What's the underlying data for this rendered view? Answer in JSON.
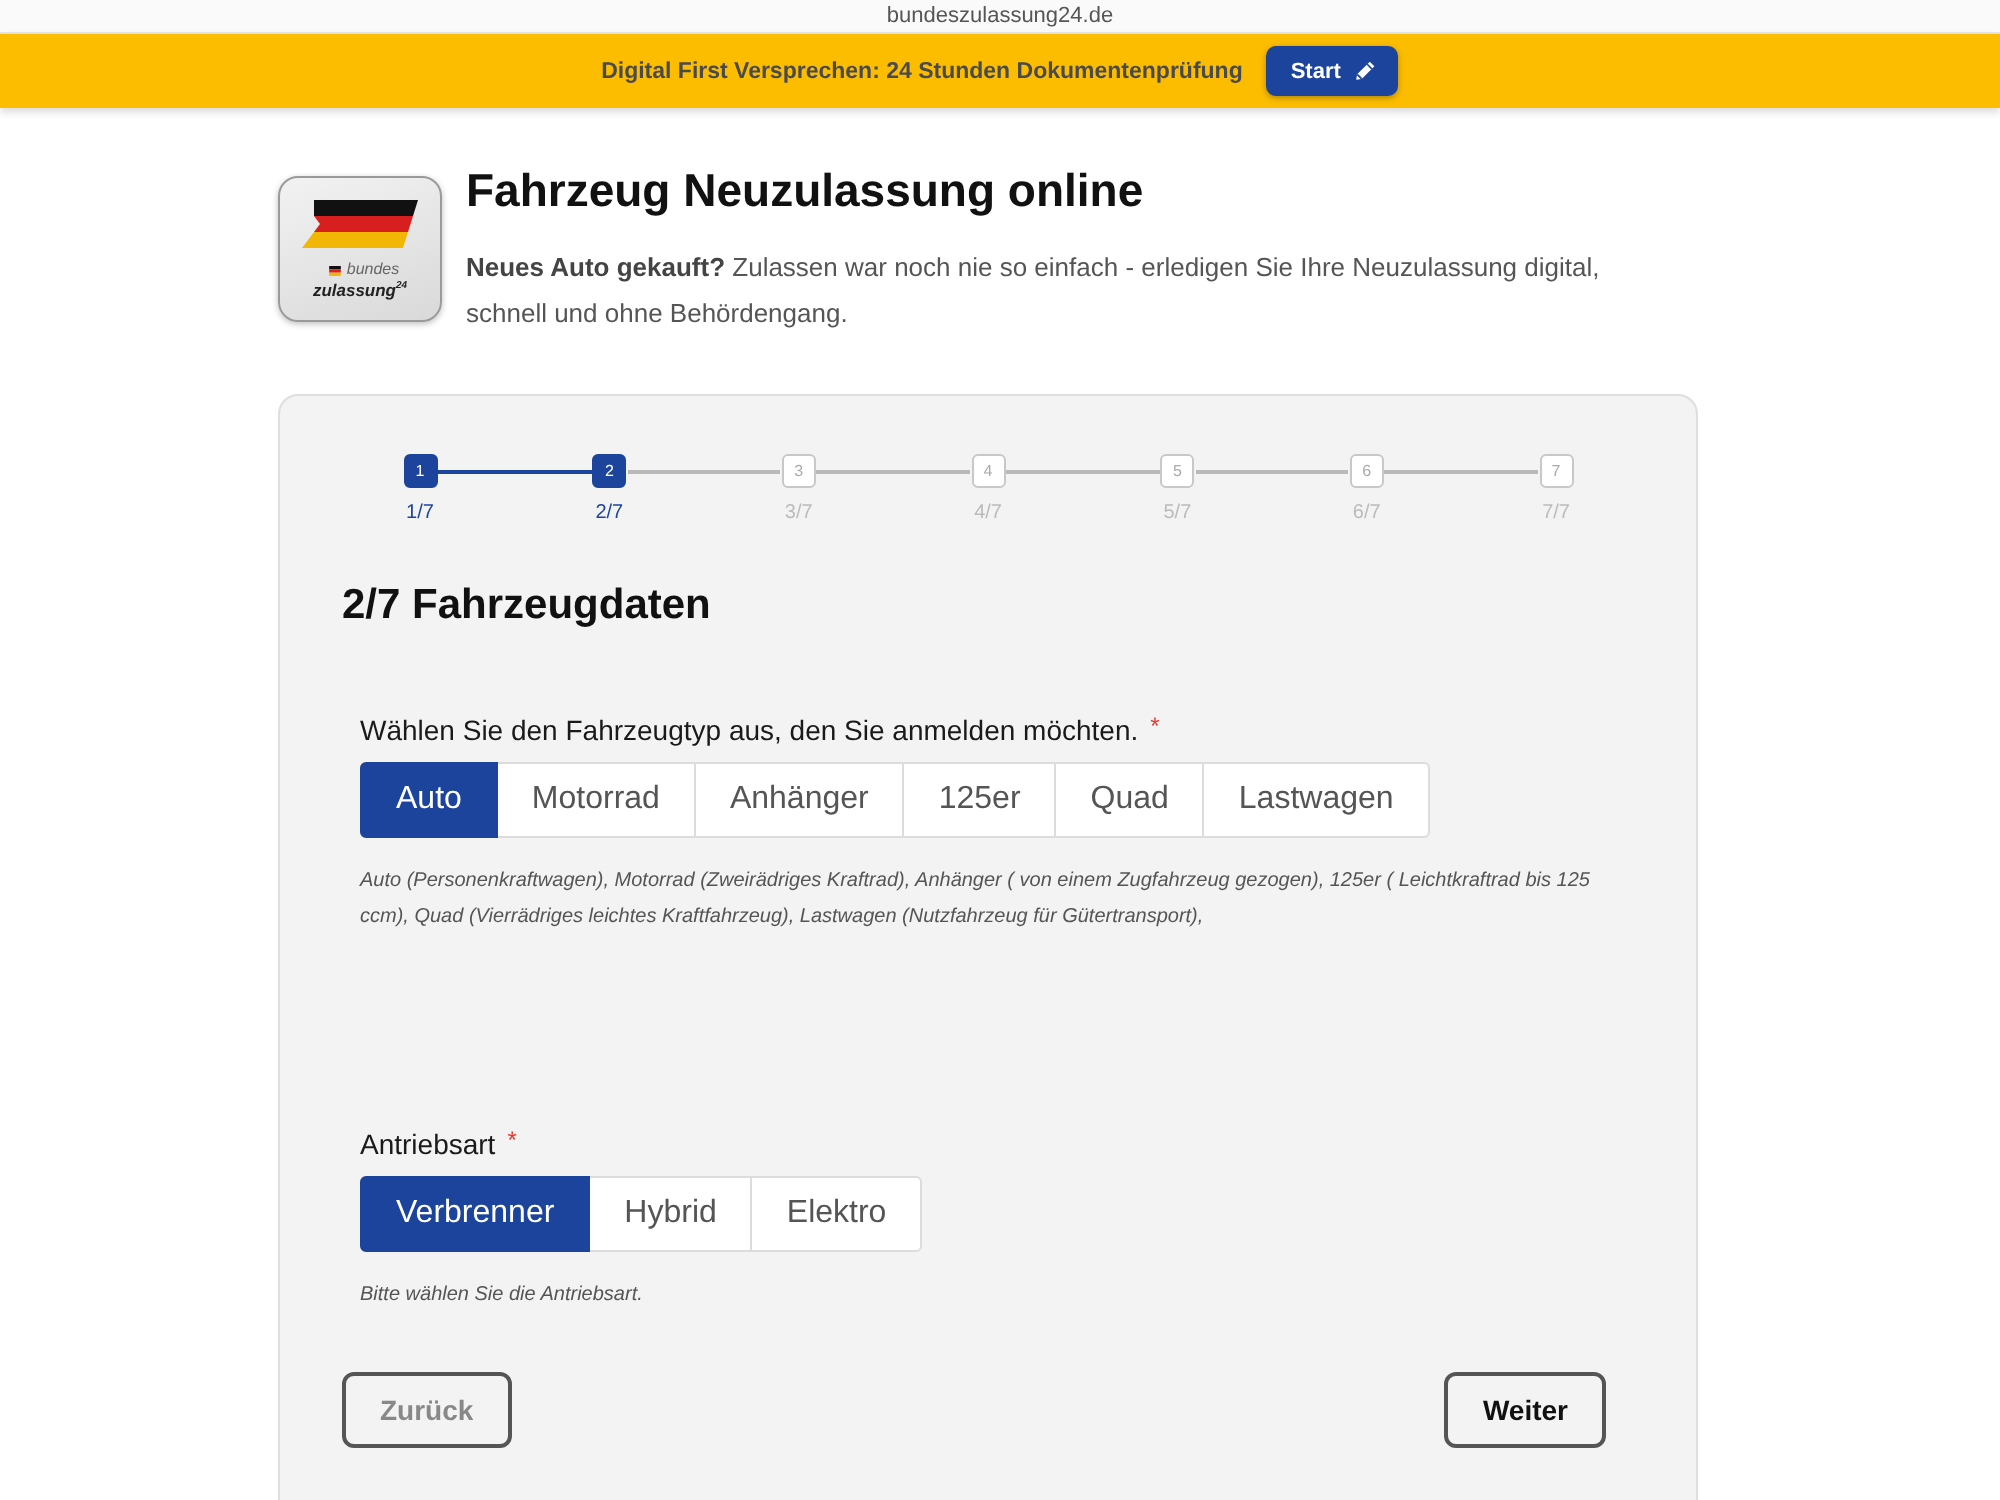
{
  "browser": {
    "url": "bundeszulassung24.de"
  },
  "banner": {
    "text": "Digital First Versprechen: 24 Stunden Dokumentenprüfung",
    "button": {
      "label": "Start"
    }
  },
  "header": {
    "logo": {
      "line_1": "bundes",
      "line_2": "zulassung$^{24}$"
    },
    "title": "Fahrzeug Neuzulassung online",
    "intro": "**Neues Auto gekauft?** Zulassen war noch nie so einfach - erledigen Sie Ihre Neuzulassung digital, schnell und ohne Behördengang."
  },
  "stepper": {
    "steps": [
      {
        "number": "1",
        "label": "1/7",
        "completed": true
      },
      {
        "number": "2",
        "label": "2/7",
        "completed": true
      },
      {
        "number": "3",
        "label": "3/7",
        "completed": false
      },
      {
        "number": "4",
        "label": "4/7",
        "completed": false
      },
      {
        "number": "5",
        "label": "5/7",
        "completed": false
      },
      {
        "number": "6",
        "label": "6/7",
        "completed": false
      },
      {
        "number": "7",
        "label": "7/7",
        "completed": false
      }
    ]
  },
  "form": {
    "heading": "2/7 Fahrzeugdaten",
    "fields": [
      {
        "label": "Wählen Sie den Fahrzeugtyp aus, den Sie anmelden möchten.",
        "required_mark": "*",
        "options": [
          {
            "label": "Auto",
            "selected": true
          },
          {
            "label": "Motorrad",
            "selected": false
          },
          {
            "label": "Anhänger",
            "selected": false
          },
          {
            "label": "125er",
            "selected": false
          },
          {
            "label": "Quad",
            "selected": false
          },
          {
            "label": "Lastwagen",
            "selected": false
          }
        ],
        "help": "Auto (Personenkraftwagen), Motorrad (Zweirädriges Kraftrad), Anhänger ( von einem Zugfahrzeug gezogen), 125er ( Leichtkraftrad bis 125 ccm), Quad (Vierrädriges leichtes Kraftfahrzeug), Lastwagen (Nutzfahrzeug für Gütertransport),"
      },
      {
        "label": "Antriebsart",
        "required_mark": "*",
        "options": [
          {
            "label": "Verbrenner",
            "selected": true
          },
          {
            "label": "Hybrid",
            "selected": false
          },
          {
            "label": "Elektro",
            "selected": false
          }
        ],
        "help": "Bitte wählen Sie die Antriebsart."
      }
    ]
  },
  "navigation": [
    {
      "label": "Zurück",
      "disabled": true
    },
    {
      "label": "Weiter",
      "disabled": false
    }
  ]
}
